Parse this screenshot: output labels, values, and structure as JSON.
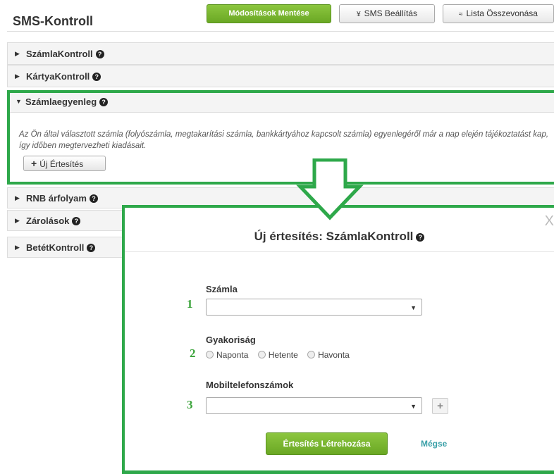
{
  "header": {
    "title": "SMS-Kontroll",
    "save_label": "Módosítások Mentése",
    "sms_settings_label": "SMS Beállítás",
    "merge_list_label": "Lista Összevonása"
  },
  "accordion": {
    "items": [
      {
        "label": "SzámlaKontroll"
      },
      {
        "label": "KártyaKontroll"
      },
      {
        "label": "Számlaegyenleg"
      },
      {
        "label": "RNB árfolyam"
      },
      {
        "label": "Zárolások"
      },
      {
        "label": "BetétKontroll"
      }
    ],
    "open_description": "Az Ön által választott számla (folyószámla, megtakarítási számla, bankkártyához kapcsolt számla) egyenlegéről már a nap elején tájékoztatást kap, így időben megtervezheti kiadásait.",
    "new_alert_label": "Új Értesítés"
  },
  "modal": {
    "title": "Új értesítés: SzámlaKontroll",
    "close": "X",
    "account_label": "Számla",
    "account_value": "",
    "frequency_label": "Gyakoriság",
    "frequency_options": [
      "Naponta",
      "Hetente",
      "Havonta"
    ],
    "phones_label": "Mobiltelefonszámok",
    "phones_value": "",
    "add_symbol": "+",
    "create_label": "Értesítés Létrehozása",
    "cancel_label": "Mégse"
  },
  "annotations": {
    "numbers": [
      "1",
      "2",
      "3"
    ],
    "color": "#2ea84a"
  },
  "icons": {
    "help": "question-circle-icon",
    "expand": "triangle-right-icon",
    "collapse": "triangle-down-icon",
    "plus": "plus-icon",
    "dropdown": "caret-down-icon"
  }
}
